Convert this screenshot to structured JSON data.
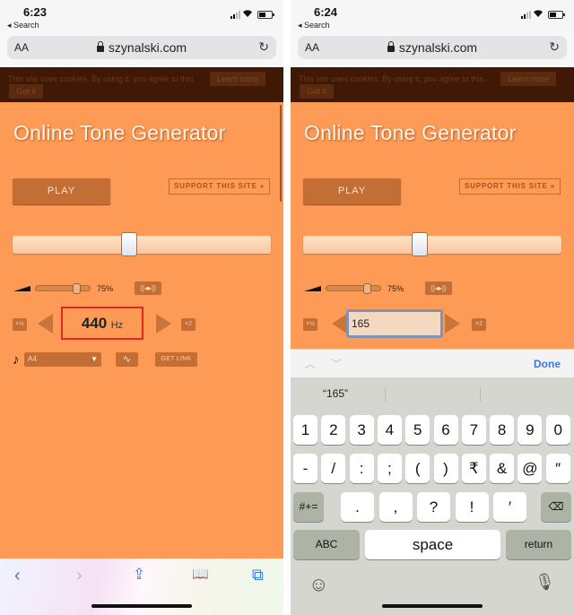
{
  "left": {
    "status": {
      "time": "6:23",
      "back_label": "◂ Search"
    },
    "url_bar": {
      "text_size_label": "AA",
      "url": "szynalski.com",
      "reload_icon": "↻"
    },
    "cookie_banner": {
      "text": "This site uses cookies. By using it, you agree to this.",
      "learn_more": "Learn more",
      "got_it": "Got it"
    },
    "page": {
      "title": "Online Tone Generator",
      "play_label": "PLAY",
      "support_label": "SUPPORT THIS SITE »",
      "frequency_slider_fraction": 0.45,
      "volume_fraction": 0.75,
      "volume_label": "75%",
      "balance_label": "(|◂▸|)",
      "halve_label": "×½",
      "double_label": "×2",
      "frequency_value": "440",
      "frequency_unit": "Hz",
      "note_icon": "♪",
      "note_value": "A4",
      "note_caret": "▼",
      "waveform_icon": "∿",
      "get_link_label": "GET LINK"
    },
    "toolbar": {
      "back": "‹",
      "forward": "›",
      "share": "⇪",
      "bookmarks": "📖",
      "tabs": "⧉"
    }
  },
  "right": {
    "status": {
      "time": "6:24",
      "back_label": "◂ Search"
    },
    "url_bar": {
      "text_size_label": "AA",
      "url": "szynalski.com",
      "reload_icon": "↻"
    },
    "cookie_banner": {
      "text": "This site uses cookies. By using it, you agree to this.",
      "learn_more": "Learn more",
      "got_it": "Got it"
    },
    "page": {
      "title": "Online Tone Generator",
      "play_label": "PLAY",
      "support_label": "SUPPORT THIS SITE »",
      "frequency_slider_fraction": 0.45,
      "volume_fraction": 0.75,
      "volume_label": "75%",
      "balance_label": "(|◂▸|)",
      "halve_label": "×½",
      "double_label": "×2",
      "frequency_input_value": "165"
    },
    "accessory_bar": {
      "prev": "︿",
      "next": "﹀",
      "done": "Done"
    },
    "keyboard": {
      "suggestion": "“165”",
      "row1": [
        "1",
        "2",
        "3",
        "4",
        "5",
        "6",
        "7",
        "8",
        "9",
        "0"
      ],
      "row2": [
        "-",
        "/",
        ":",
        ";",
        "(",
        ")",
        "₹",
        "&",
        "@",
        "″"
      ],
      "row3_fn": "#+=",
      "row3": [
        ".",
        ",",
        "?",
        "!",
        "′"
      ],
      "delete_icon": "⌫",
      "abc": "ABC",
      "space": "space",
      "return": "return",
      "emoji_icon": "☺",
      "mic_icon": "🎙"
    }
  }
}
